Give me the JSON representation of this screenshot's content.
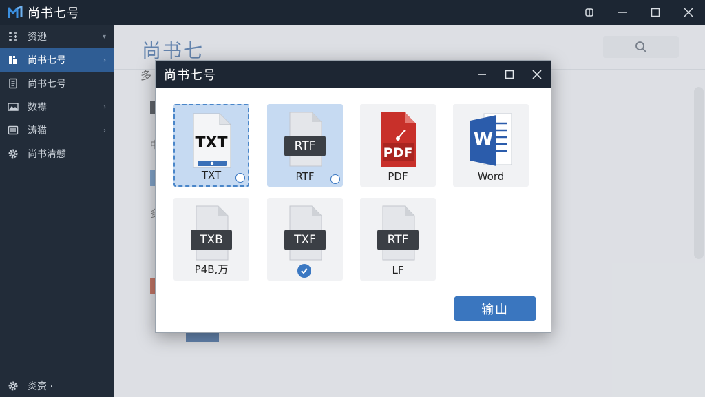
{
  "app": {
    "title": "尚书七号"
  },
  "sidebar": {
    "items": [
      {
        "label": "资逊",
        "icon": "grid-icon",
        "active": false,
        "chevron": true
      },
      {
        "label": "尚书七号",
        "icon": "home-icon",
        "active": true,
        "chevron": true
      },
      {
        "label": "尚书七号",
        "icon": "document-icon",
        "active": false,
        "chevron": false
      },
      {
        "label": "数襟",
        "icon": "image-icon",
        "active": false,
        "chevron": true
      },
      {
        "label": "涛猫",
        "icon": "list-icon",
        "active": false,
        "chevron": true
      },
      {
        "label": "尚书清戆",
        "icon": "gear-icon",
        "active": false,
        "chevron": false
      }
    ],
    "footer": {
      "label": "炎赍 ·",
      "icon": "gear-icon"
    }
  },
  "main": {
    "title": "尚书七",
    "subtitle": "多",
    "fragments": [
      "中",
      "多"
    ]
  },
  "dialog": {
    "title": "尚书七号",
    "export_label": "输山",
    "tiles": [
      {
        "label": "TXT",
        "badge": "TXT",
        "selected": true,
        "dashed": true,
        "check": true
      },
      {
        "label": "RTF",
        "badge": "RTF",
        "selected": true,
        "dashed": false,
        "check": true
      },
      {
        "label": "PDF",
        "badge": "PDF",
        "selected": false,
        "dashed": false,
        "check": false
      },
      {
        "label": "Word",
        "badge": "W",
        "selected": false,
        "dashed": false,
        "check": false
      },
      {
        "label": "P4B,万",
        "badge": "TXB",
        "selected": false,
        "dashed": false,
        "check": false
      },
      {
        "label": "",
        "badge": "TXF",
        "selected": false,
        "dashed": false,
        "check": true
      },
      {
        "label": "LF",
        "badge": "RTF",
        "selected": false,
        "dashed": false,
        "check": false
      }
    ]
  },
  "colors": {
    "accent": "#3a76bf",
    "sidebar_active": "#2f5d94",
    "titlebar": "#1c2633",
    "pdf_red": "#c8302a",
    "word_blue": "#2b5cab"
  }
}
